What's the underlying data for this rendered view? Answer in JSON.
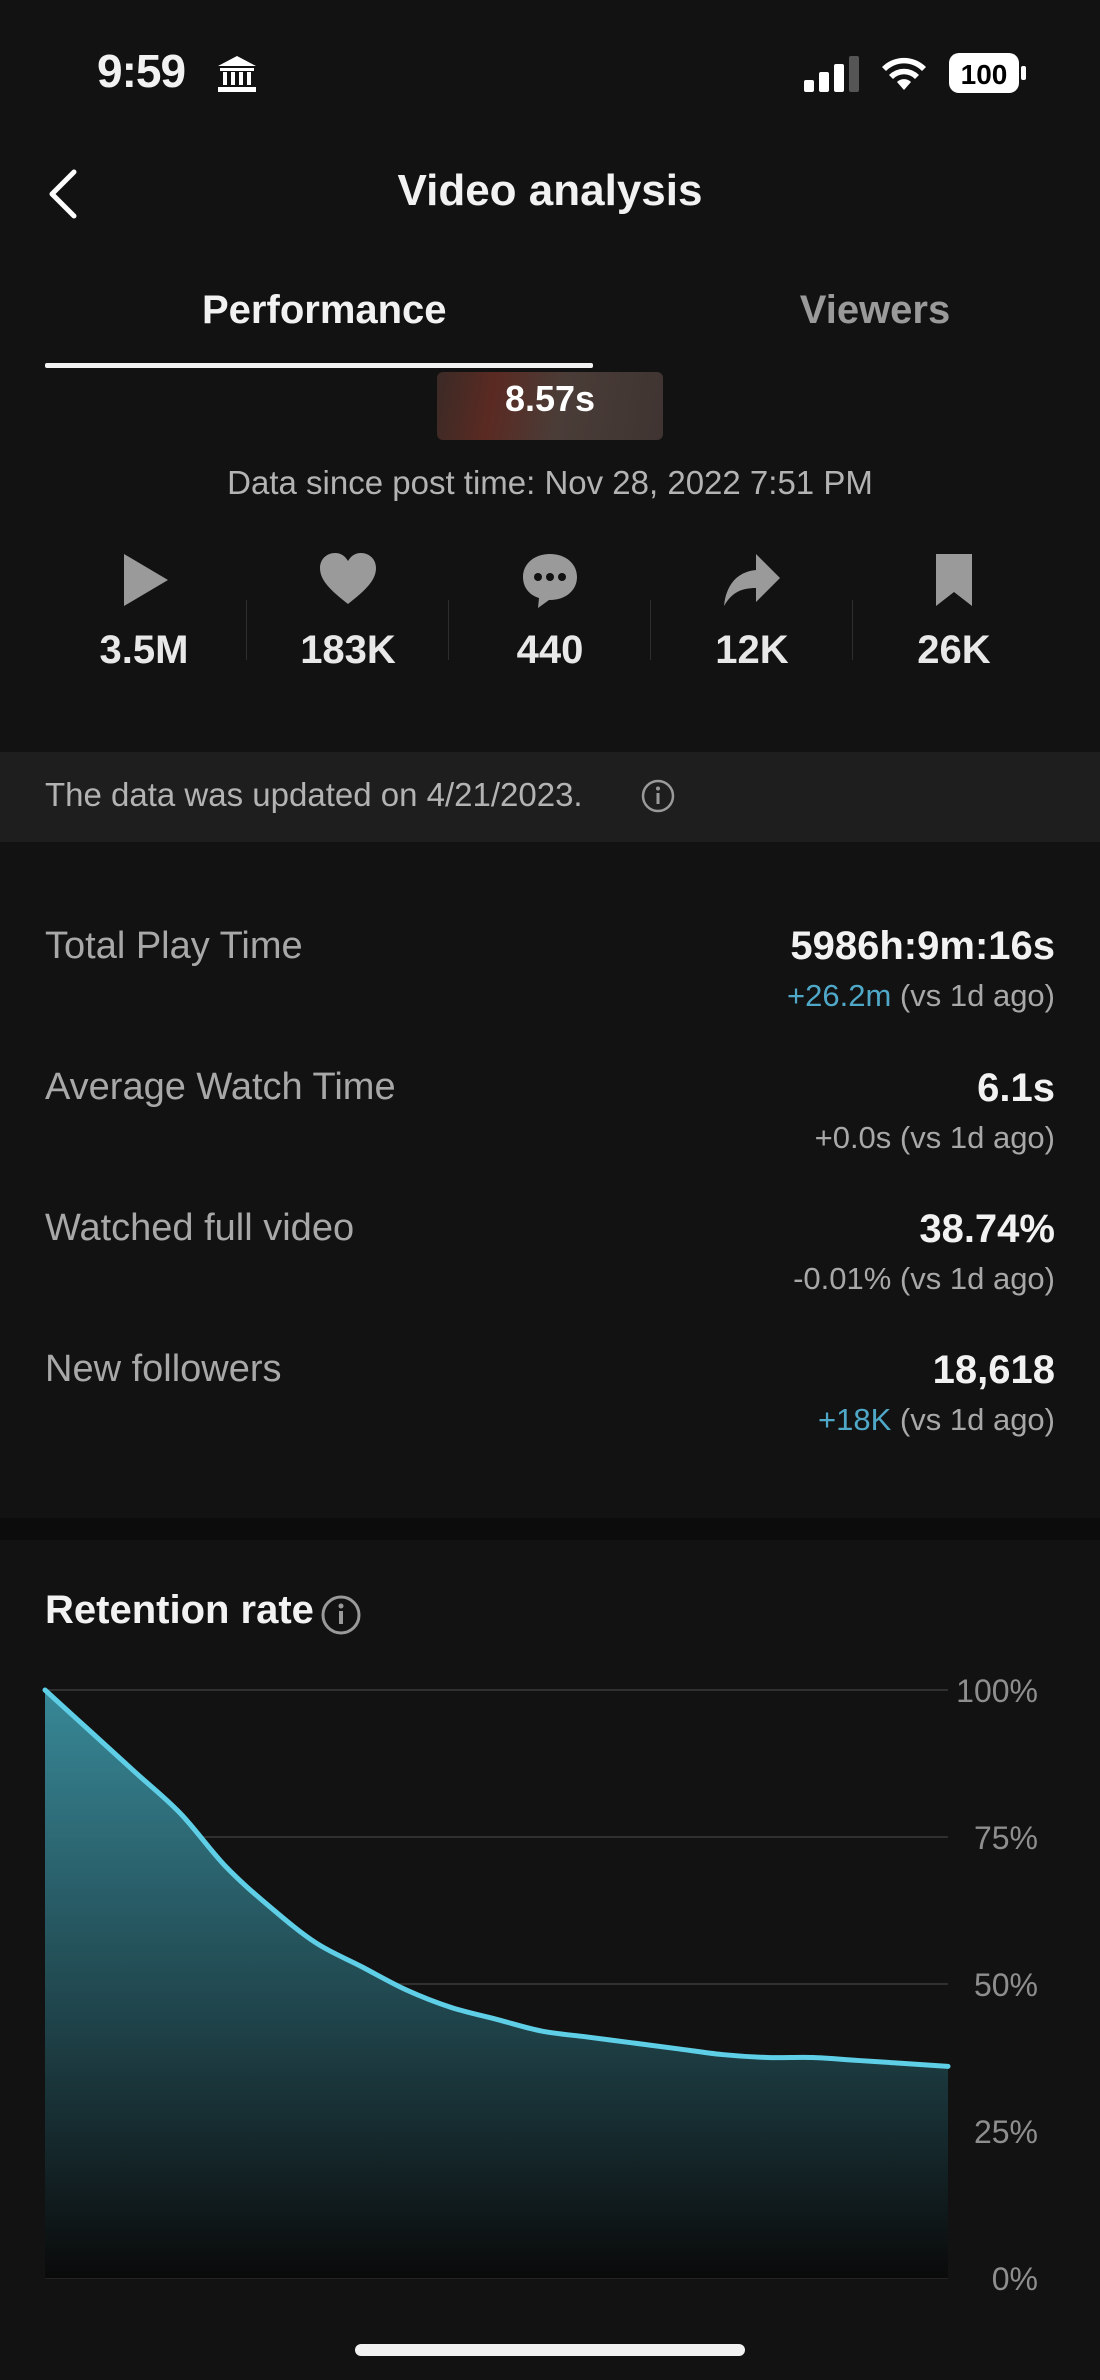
{
  "status_bar": {
    "time": "9:59",
    "battery": "100"
  },
  "header": {
    "title": "Video analysis"
  },
  "tabs": [
    {
      "label": "Performance",
      "active": true
    },
    {
      "label": "Viewers",
      "active": false
    }
  ],
  "thumbnail": {
    "duration": "8.57s"
  },
  "since_text": "Data since post time: Nov 28, 2022 7:51 PM",
  "stats": [
    {
      "icon": "play-icon",
      "value": "3.5M"
    },
    {
      "icon": "heart-icon",
      "value": "183K"
    },
    {
      "icon": "comment-icon",
      "value": "440"
    },
    {
      "icon": "share-icon",
      "value": "12K"
    },
    {
      "icon": "bookmark-icon",
      "value": "26K"
    }
  ],
  "updated_text": "The data was updated on 4/21/2023.",
  "metrics": [
    {
      "label": "Total Play Time",
      "value": "5986h:9m:16s",
      "change": "+26.2m",
      "change_type": "positive",
      "compare": "(vs 1d ago)"
    },
    {
      "label": "Average Watch Time",
      "value": "6.1s",
      "change": "+0.0s",
      "change_type": "neutral",
      "compare": "(vs 1d ago)"
    },
    {
      "label": "Watched full video",
      "value": "38.74%",
      "change": "-0.01%",
      "change_type": "neutral",
      "compare": "(vs 1d ago)"
    },
    {
      "label": "New followers",
      "value": "18,618",
      "change": "+18K",
      "change_type": "positive",
      "compare": "(vs 1d ago)"
    }
  ],
  "retention": {
    "title": "Retention rate"
  },
  "colors": {
    "accent": "#4fa8c8",
    "line": "#5ecfe6",
    "background": "#121212"
  },
  "chart_data": {
    "type": "area",
    "title": "Retention rate",
    "ylim": [
      0,
      100
    ],
    "y_ticks": [
      "100%",
      "75%",
      "50%",
      "25%",
      "0%"
    ],
    "grid": true,
    "x": [
      0,
      0.05,
      0.1,
      0.15,
      0.2,
      0.25,
      0.3,
      0.35,
      0.4,
      0.45,
      0.5,
      0.55,
      0.6,
      0.65,
      0.7,
      0.75,
      0.8,
      0.85,
      0.9,
      0.95,
      1.0
    ],
    "values": [
      100,
      93,
      86,
      79,
      70,
      63,
      57,
      53,
      49,
      46,
      44,
      42,
      41,
      40,
      39,
      38,
      37.5,
      37.5,
      37,
      36.5,
      36
    ]
  }
}
